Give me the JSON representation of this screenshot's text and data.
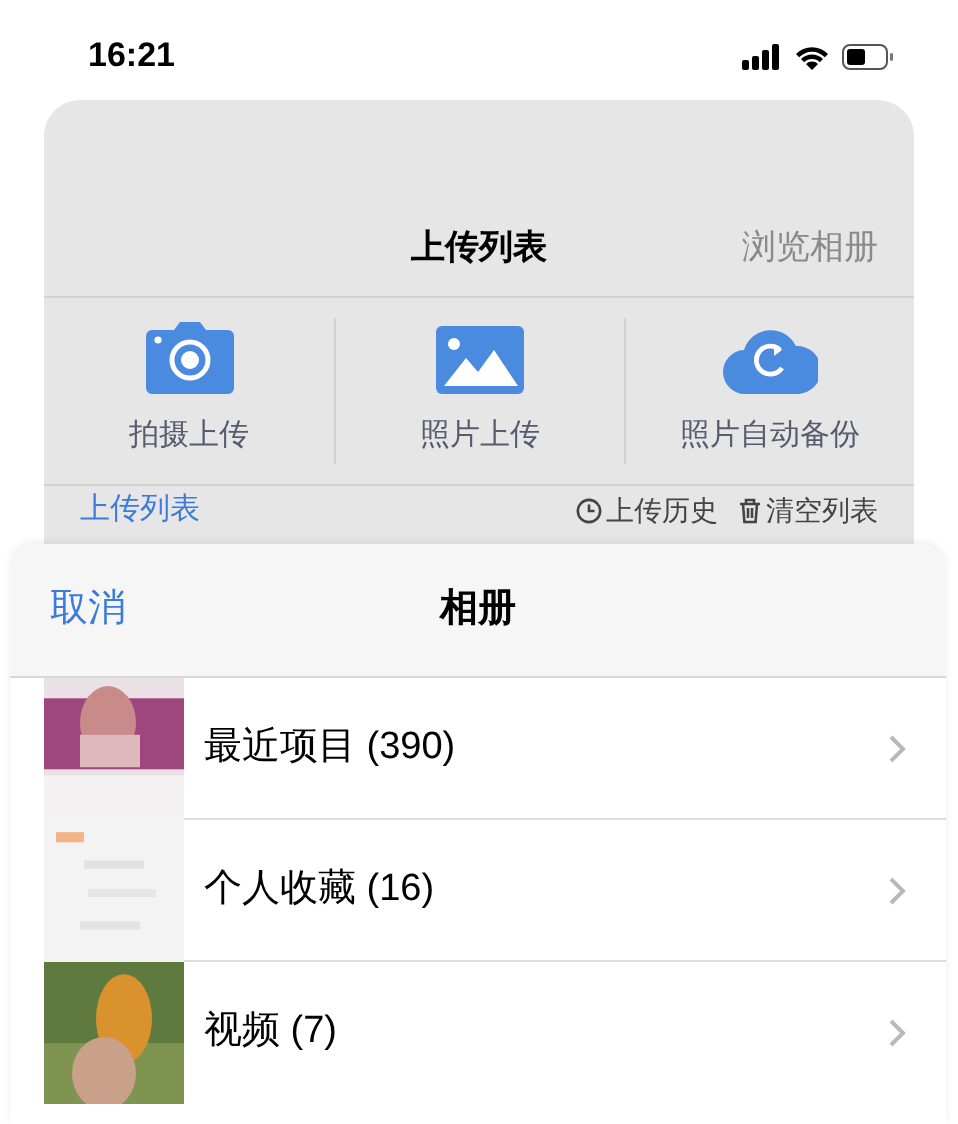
{
  "status_bar": {
    "time": "16:21"
  },
  "upload_page": {
    "title": "上传列表",
    "browse_link": "浏览相册",
    "actions": [
      {
        "kind": "camera",
        "label": "拍摄上传"
      },
      {
        "label": "照片上传"
      },
      {
        "kind": "cloud",
        "label": "照片自动备份"
      }
    ],
    "list_header": {
      "title": "上传列表",
      "history": "上传历史",
      "clear": "清空列表"
    }
  },
  "album_sheet": {
    "cancel": "取消",
    "title": "相册",
    "albums": [
      {
        "label": "最近项目 (390)"
      },
      {
        "label": "个人收藏 (16)"
      },
      {
        "label": "视频 (7)"
      }
    ]
  }
}
